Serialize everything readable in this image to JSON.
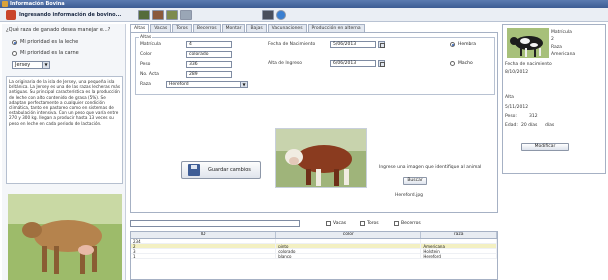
{
  "window": {
    "title": "Información Bovina"
  },
  "toolbar": {
    "title": "Ingresando información de bovino..."
  },
  "left": {
    "question": "¿Qué raza de ganado desea manejar e...?",
    "options": [
      {
        "label": "Mi prioridad es la leche",
        "selected": true
      },
      {
        "label": "Mi prioridad es la carne",
        "selected": false
      }
    ],
    "breed_value": "Jersey",
    "description": "La originaria de la isla de Jersey, una pequeña isla británica. La Jersey es una de las razas lecheras más antiguas. Su principal característica es la producción de leche con alto contenido de grasa (5%). Se adaptan perfectamente a cualquier condición climática, tanto en pastoreo como en sistemas de estabulación intensiva. Con un peso que varía entre 270 y 300 kg. llegan a producir hasta 13 veces su peso en leche en cada periodo de lactación."
  },
  "tabs": [
    "Altas",
    "Vacas",
    "Toros",
    "Becerros",
    "Montar",
    "Bajas",
    "Vacunaciones",
    "Producción en alterna"
  ],
  "form": {
    "legend": "Altas",
    "labels": {
      "matricula": "Matrícula",
      "color": "Color",
      "peso": "Peso",
      "no_acta": "No. Acta",
      "raza": "Raza",
      "fecha_nacimiento": "Fecha de Nacimiento",
      "alta_ingreso": "Alta de Ingreso"
    },
    "values": {
      "matricula": "4",
      "color": "colorado",
      "peso": "336",
      "no_acta": "289",
      "raza": "Hereford",
      "fecha_nacimiento": "5/06/2013",
      "alta_ingreso": "6/06/2013"
    },
    "sex": {
      "hembra": "Hembra",
      "macho": "Macho",
      "selected": "hembra"
    },
    "save_label": "Guardar cambios",
    "image_prompt": "Ingrese una imagen que identifique al animal",
    "search_label": "Buscar",
    "image_filename": "Hereford.jpg"
  },
  "filters": {
    "vacas": "Vacas",
    "toros": "Toros",
    "becerros": "Becerros"
  },
  "grid": {
    "columns": [
      "ID",
      "color",
      "raza"
    ],
    "rows": [
      [
        "234",
        "",
        ""
      ],
      [
        "2",
        "pinto",
        "Americana"
      ],
      [
        "3",
        "colorado",
        "Holstein"
      ],
      [
        "1",
        "blanco",
        "Hereford"
      ]
    ],
    "selected_row": 1
  },
  "right": {
    "matricula_label": "Matrícula",
    "matricula_value": "2",
    "raza_label": "Raza",
    "raza_value": "Americana",
    "fecha_label": "Fecha de nacimiento",
    "fecha_value": "8/10/2012",
    "alta_label": "Alta",
    "alta_value": "5/11/2012",
    "peso_label": "Peso:",
    "peso_value": "312",
    "edad_label": "Edad:",
    "edad_value": "20 días",
    "edad_suffix": "días",
    "modify_label": "Modificar"
  },
  "colors": {
    "titlebar": "#3d5c93",
    "selected_row": "#f3f0c2",
    "accent": "#2f5fb3"
  }
}
